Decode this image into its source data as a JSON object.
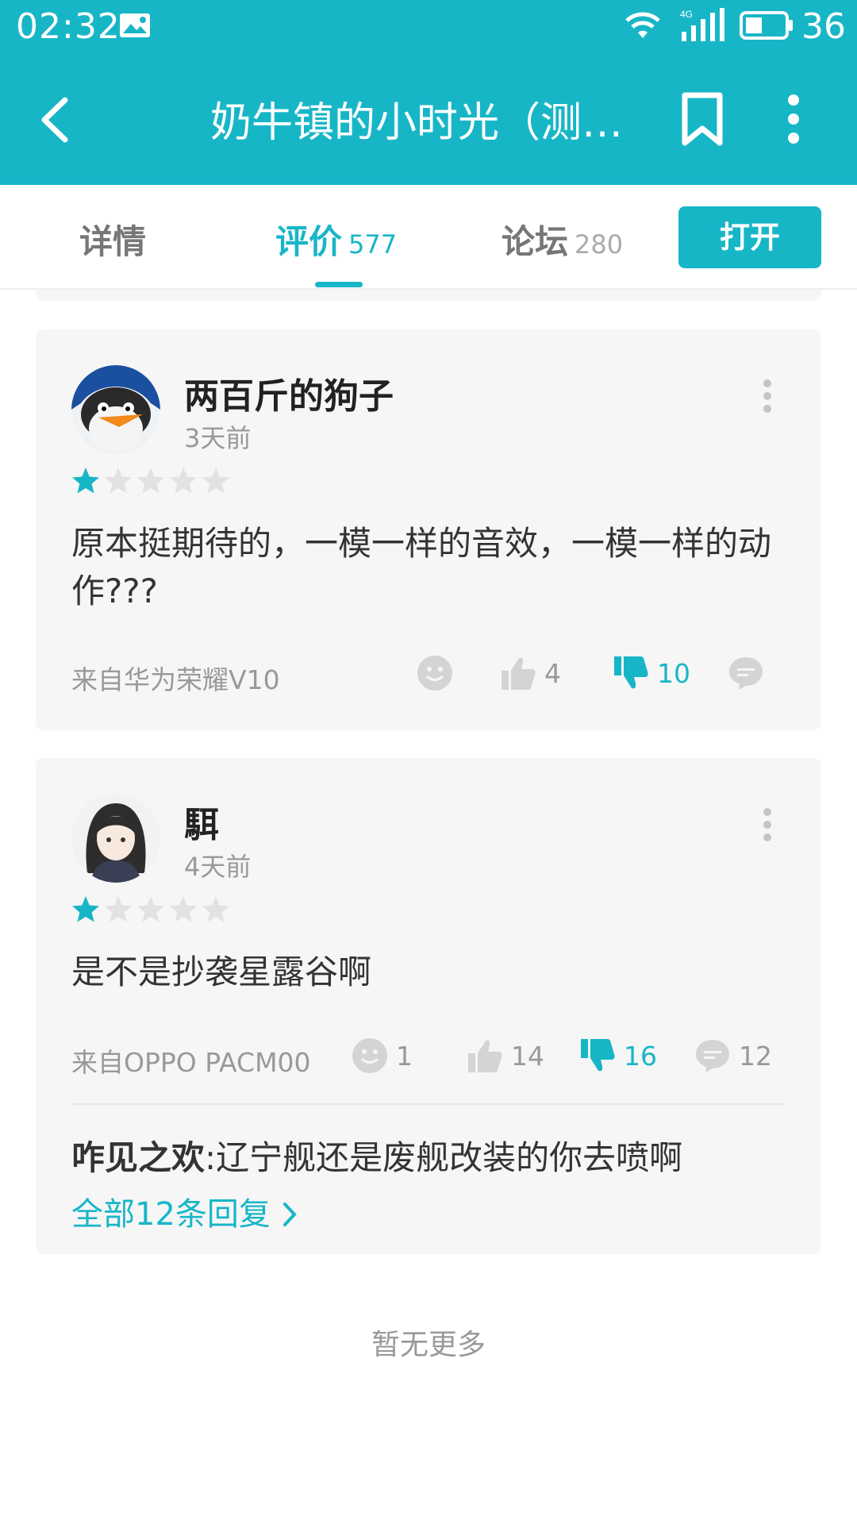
{
  "status_bar": {
    "time": "02:32",
    "battery": "36"
  },
  "app_bar": {
    "title": "奶牛镇的小时光（测试版）"
  },
  "tabs": [
    {
      "label": "详情",
      "count": ""
    },
    {
      "label": "评价",
      "count": "577"
    },
    {
      "label": "论坛",
      "count": "280"
    }
  ],
  "open_button": "打开",
  "reviews": [
    {
      "username": "两百斤的狗子",
      "time": "3天前",
      "rating": 1,
      "rating_max": 5,
      "content": "原本挺期待的，一模一样的音效，一模一样的动作???",
      "source": "来自华为荣耀V10",
      "emoji_count": "",
      "like_count": "4",
      "dislike_count": "10",
      "comment_count": ""
    },
    {
      "username": "駬",
      "time": "4天前",
      "rating": 1,
      "rating_max": 5,
      "content": "是不是抄袭星露谷啊",
      "source": "来自OPPO PACM00",
      "emoji_count": "1",
      "like_count": "14",
      "dislike_count": "16",
      "comment_count": "12",
      "reply": {
        "author": "咋见之欢",
        "separator": ":",
        "text": "辽宁舰还是废舰改装的你去喷啊"
      },
      "all_replies": "全部12条回复"
    }
  ],
  "no_more": "暂无更多",
  "colors": {
    "accent": "#17b6c7",
    "card_bg": "#f6f6f6",
    "muted": "#999999"
  }
}
